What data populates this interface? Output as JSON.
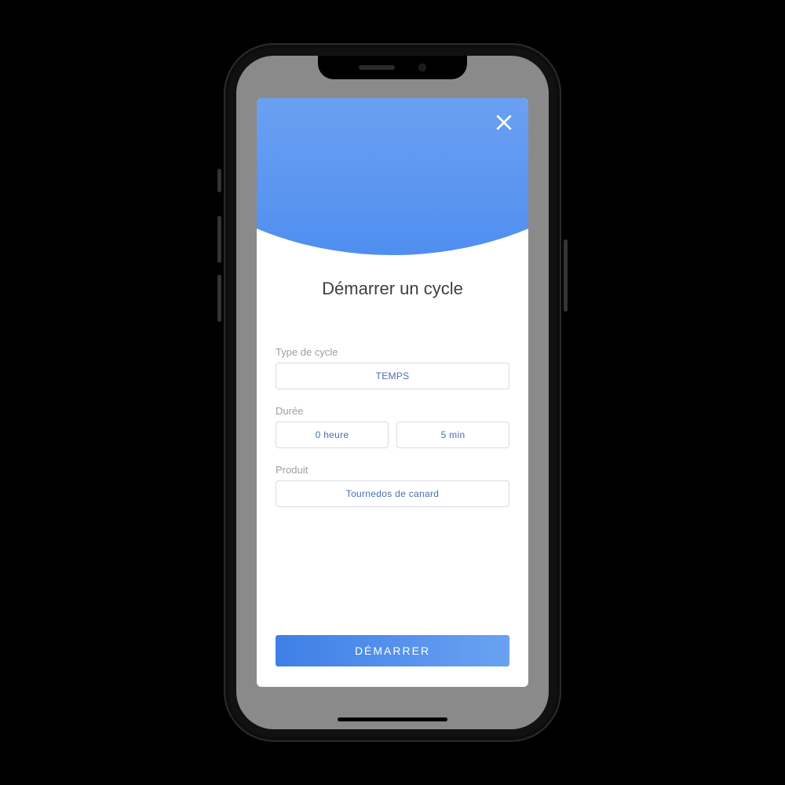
{
  "modal": {
    "title": "Démarrer un cycle",
    "close_icon": "close-icon",
    "fields": {
      "cycle_type": {
        "label": "Type de cycle",
        "value": "TEMPS"
      },
      "duration": {
        "label": "Durée",
        "hours_value": "0 heure",
        "minutes_value": "5 min"
      },
      "product": {
        "label": "Produit",
        "value": "Tournedos de canard"
      }
    },
    "start_button_label": "DÉMARRER"
  },
  "colors": {
    "accent_light": "#a7c7f5",
    "accent_dark": "#4f8ef0",
    "field_text": "#4b6db3",
    "label_grey": "#9aa0a6"
  }
}
